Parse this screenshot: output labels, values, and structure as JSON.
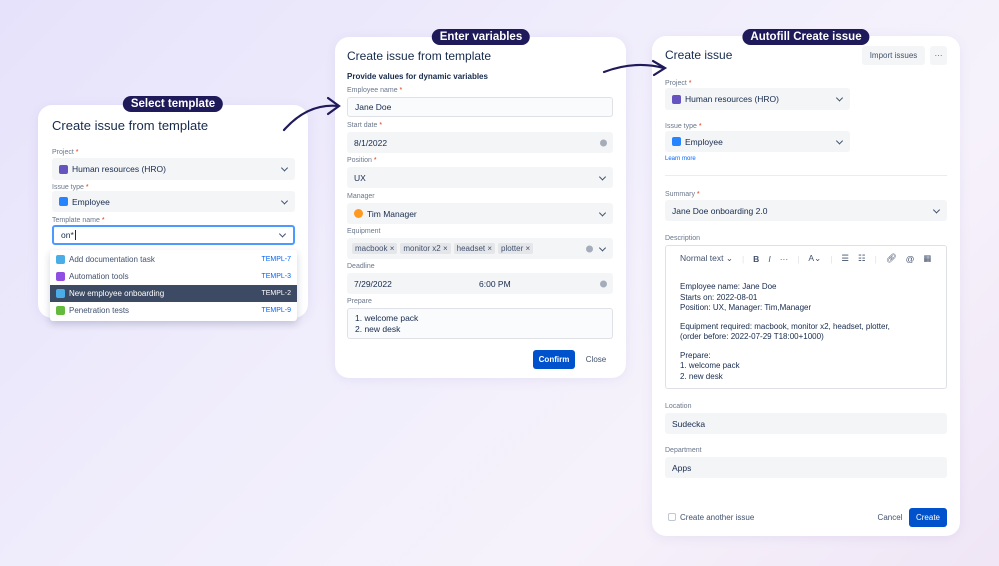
{
  "colors": {
    "accent": "#0052cc",
    "badge": "#1f1a5a",
    "highlight": "#3d4a63"
  },
  "step1": {
    "badge": "Select template",
    "title": "Create issue from template",
    "project_label": "Project",
    "project_value": "Human resources (HRO)",
    "issue_type_label": "Issue type",
    "issue_type_value": "Employee",
    "template_label": "Template name",
    "template_value": "on*",
    "options": [
      {
        "label": "Add documentation task",
        "key": "TEMPL-7",
        "icon": "checkbox-icon",
        "color": "#4bade8"
      },
      {
        "label": "Automation tools",
        "key": "TEMPL-3",
        "icon": "lightning-icon",
        "color": "#904ee2"
      },
      {
        "label": "New employee onboarding",
        "key": "TEMPL-2",
        "icon": "checkbox-icon",
        "color": "#4bade8",
        "selected": true
      },
      {
        "label": "Penetration tests",
        "key": "TEMPL-9",
        "icon": "story-icon",
        "color": "#63ba3c"
      }
    ]
  },
  "step2": {
    "badge": "Enter variables",
    "title": "Create issue from template",
    "subtitle": "Provide values for dynamic variables",
    "employee_label": "Employee name",
    "employee_value": "Jane Doe",
    "start_label": "Start date",
    "start_value": "8/1/2022",
    "position_label": "Position",
    "position_value": "UX",
    "manager_label": "Manager",
    "manager_value": "Tim Manager",
    "equipment_label": "Equipment",
    "equipment": [
      "macbook",
      "monitor x2",
      "headset",
      "plotter"
    ],
    "deadline_label": "Deadline",
    "deadline_date": "7/29/2022",
    "deadline_time": "6:00 PM",
    "prepare_label": "Prepare",
    "prepare_lines": [
      "1. welcome pack",
      "2. new desk"
    ],
    "confirm": "Confirm",
    "close": "Close"
  },
  "step3": {
    "badge": "Autofill Create issue",
    "title": "Create issue",
    "import": "Import issues",
    "more": "···",
    "project_label": "Project",
    "project_value": "Human resources (HRO)",
    "issue_type_label": "Issue type",
    "issue_type_value": "Employee",
    "learn_more": "Learn more",
    "summary_label": "Summary",
    "summary_value": "Jane Doe onboarding 2.0",
    "description_label": "Description",
    "text_style": "Normal text",
    "description": [
      "Employee name: Jane Doe",
      "Starts on: 2022-08-01",
      "Position: UX, Manager: Tim,Manager",
      "Equipment required: macbook, monitor x2, headset, plotter,",
      "(order before: 2022-07-29 T18:00+1000)",
      "Prepare:",
      "1. welcome pack",
      "2. new desk"
    ],
    "location_label": "Location",
    "location_value": "Sudecka",
    "department_label": "Department",
    "department_value": "Apps",
    "create_another": "Create another issue",
    "cancel": "Cancel",
    "create": "Create"
  }
}
